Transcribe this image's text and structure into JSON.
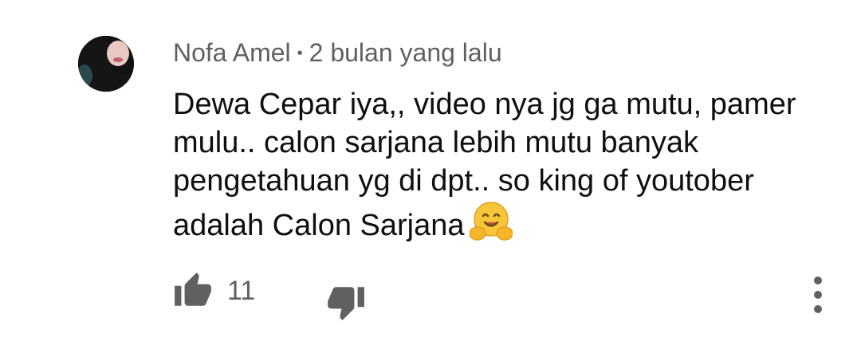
{
  "comment": {
    "author": "Nofa Amel",
    "separator": "•",
    "time": "2 bulan yang lalu",
    "text": "Dewa Cepar iya,, video nya jg ga mutu, pamer mulu.. calon sarjana lebih mutu banyak pengetahuan yg di dpt..  so king of youtober adalah Calon Sarjana",
    "emoji": "hugging-face-emoji"
  },
  "actions": {
    "like_count": "11",
    "like_icon": "thumbs-up-icon",
    "dislike_icon": "thumbs-down-icon",
    "more_icon": "more-vertical-icon"
  },
  "colors": {
    "text_primary": "#0f0f0f",
    "text_secondary": "#606060",
    "icon": "#606060"
  }
}
